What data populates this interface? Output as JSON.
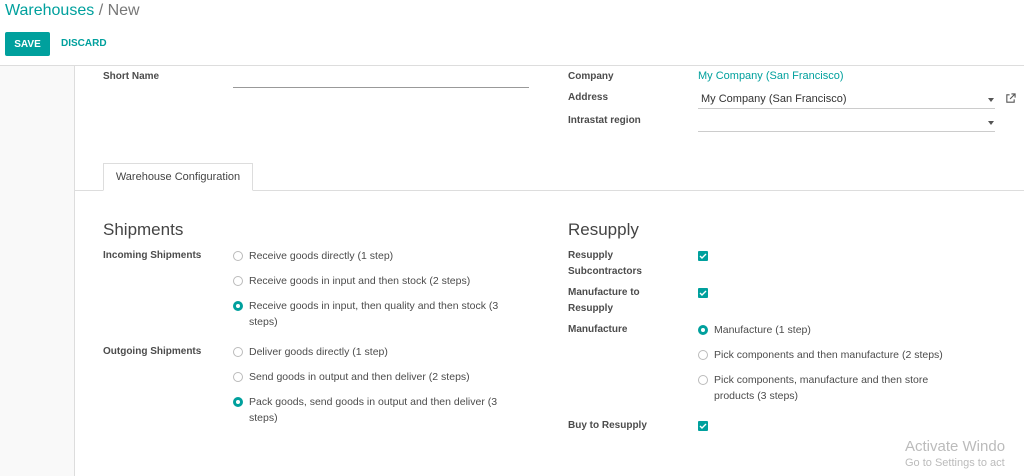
{
  "breadcrumb": {
    "parent": "Warehouses",
    "separator": "/",
    "current": "New"
  },
  "actions": {
    "save": "SAVE",
    "discard": "DISCARD"
  },
  "header": {
    "short_name_label": "Short Name",
    "short_name_value": "",
    "company_label": "Company",
    "company_value": "My Company (San Francisco)",
    "address_label": "Address",
    "address_value": "My Company (San Francisco)",
    "intrastat_label": "Intrastat region",
    "intrastat_value": ""
  },
  "tabs": [
    {
      "label": "Warehouse Configuration",
      "active": true
    }
  ],
  "shipments": {
    "title": "Shipments",
    "incoming_label": "Incoming Shipments",
    "incoming_options": [
      {
        "line1": "Receive goods directly (1 step)",
        "line2": "",
        "selected": false
      },
      {
        "line1": "Receive goods in input and then stock (2 steps)",
        "line2": "",
        "selected": false
      },
      {
        "line1": "Receive goods in input, then quality and then stock (3",
        "line2": "steps)",
        "selected": true
      }
    ],
    "outgoing_label": "Outgoing Shipments",
    "outgoing_options": [
      {
        "line1": "Deliver goods directly (1 step)",
        "line2": "",
        "selected": false
      },
      {
        "line1": "Send goods in output and then deliver (2 steps)",
        "line2": "",
        "selected": false
      },
      {
        "line1": "Pack goods, send goods in output and then deliver (3",
        "line2": "steps)",
        "selected": true
      }
    ]
  },
  "resupply": {
    "title": "Resupply",
    "resupply_subcontractors_label_1": "Resupply",
    "resupply_subcontractors_label_2": "Subcontractors",
    "resupply_subcontractors_checked": true,
    "manufacture_to_resupply_label_1": "Manufacture to",
    "manufacture_to_resupply_label_2": "Resupply",
    "manufacture_to_resupply_checked": true,
    "manufacture_label": "Manufacture",
    "manufacture_options": [
      {
        "line1": "Manufacture (1 step)",
        "line2": "",
        "selected": true
      },
      {
        "line1": "Pick components and then manufacture (2 steps)",
        "line2": "",
        "selected": false
      },
      {
        "line1": "Pick components, manufacture and then store",
        "line2": "products (3 steps)",
        "selected": false
      }
    ],
    "buy_to_resupply_label": "Buy to Resupply",
    "buy_to_resupply_checked": true
  },
  "watermark": {
    "line1": "Activate Windo",
    "line2": "Go to Settings to act"
  },
  "colors": {
    "accent": "#00a09d",
    "text": "#4c4c4c",
    "background": "#f9f9f9"
  }
}
